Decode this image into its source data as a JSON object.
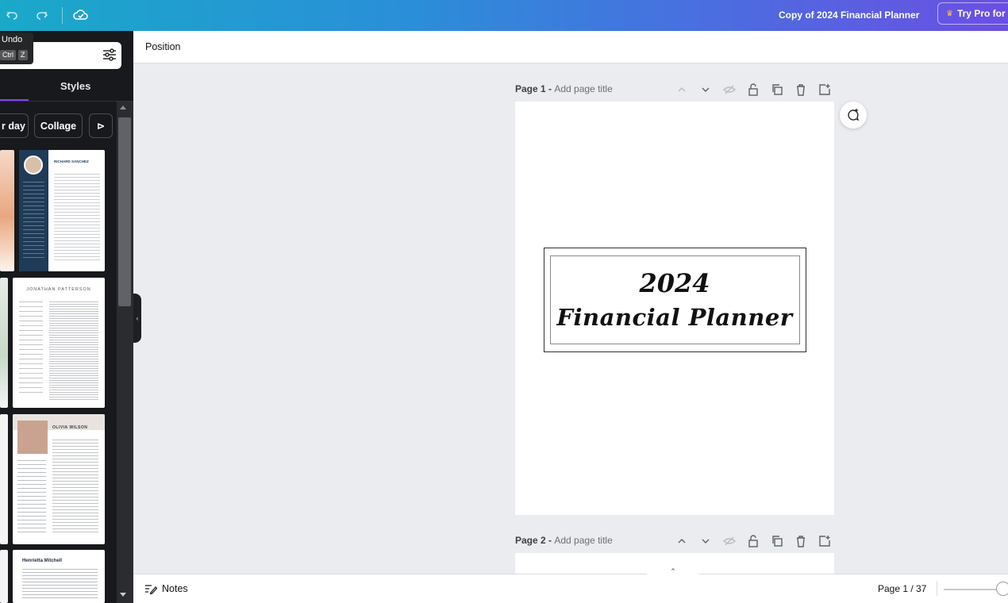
{
  "topbar": {
    "undo_icon": "undo-icon",
    "redo_icon": "redo-icon",
    "cloud_icon": "cloud-check-icon",
    "doc_title": "Copy of 2024 Financial Planner",
    "try_pro_label": "Try Pro for",
    "crown_glyph": "♛"
  },
  "tooltip": {
    "label": "Undo",
    "key_ctrl": "Ctrl",
    "key_z": "Z"
  },
  "panel": {
    "tab_styles": "Styles",
    "chips": [
      "r day",
      "Collage",
      "⊳"
    ],
    "templates": {
      "t1_name": "RICHARD SANCHEZ",
      "t2_name": "JONATHAN PATTERSON",
      "t3_name": "OLIVIA WILSON",
      "t4_name": "Henrietta Mitchell"
    }
  },
  "position_bar": {
    "label": "Position"
  },
  "pages": [
    {
      "title": "Page 1",
      "separator": " - ",
      "add_title": "Add page title"
    },
    {
      "title": "Page 2",
      "separator": " - ",
      "add_title": "Add page title"
    }
  ],
  "canvas": {
    "year": "2024",
    "subtitle": "Financial Planner"
  },
  "bottombar": {
    "notes_label": "Notes",
    "page_count": "Page 1 / 37",
    "collapse_glyph": "⌃"
  }
}
